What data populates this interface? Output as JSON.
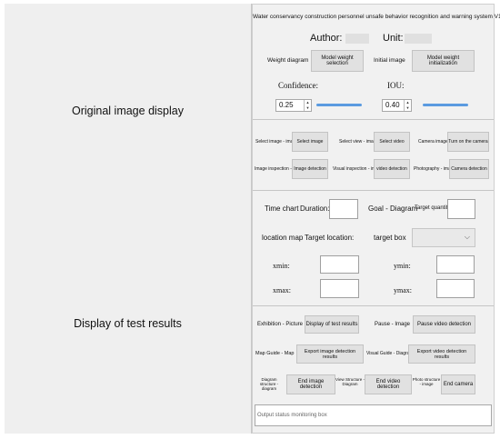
{
  "left": {
    "original_display": "Original image display",
    "results_display": "Display of test results"
  },
  "header": {
    "title": "Water conservancy construction personnel unsafe behavior recognition and warning system V1.0",
    "author_label": "Author:",
    "unit_label": "Unit:"
  },
  "weights": {
    "weight_diagram_label": "Weight diagram",
    "model_weight_selection": "Model weight selection",
    "initial_image_label": "Initial image",
    "model_weight_initialization": "Model weight initialization",
    "confidence_label": "Confidence:",
    "confidence_value": "0.25",
    "iou_label": "IOU:",
    "iou_value": "0.40"
  },
  "sources": {
    "select_image_label": "Select image - image",
    "select_image_button": "Select image",
    "select_video_label": "Select view - image",
    "select_video_button": "Select video",
    "camera_label": "Camera image",
    "camera_button": "Turn on the camera",
    "image_inspection_label": "Image inspection - image",
    "image_detection_button": "Image detection",
    "visual_inspection_label": "Visual inspection - image",
    "video_detection_button": "video detection",
    "photography_label": "Photography - image",
    "camera_detection_button": "Camera detection"
  },
  "results": {
    "time_chart_label": "Time chart",
    "duration_label": "Duration:",
    "goal_diagram_label": "Goal - Diagram",
    "target_quantity_label": "Target quantity:",
    "location_map_label": "location map",
    "target_location_label": "Target location:",
    "target_box_label": "target box",
    "xmin_label": "xmin:",
    "ymin_label": "ymin:",
    "xmax_label": "xmax:",
    "ymax_label": "ymax:"
  },
  "actions": {
    "exhibition_label": "Exhibition - Picture",
    "display_results_button": "Display of test results",
    "pause_label": "Pause - Image",
    "pause_video_button": "Pause video detection",
    "map_guide_label": "Map Guide - Map",
    "export_image_button": "Export image detection results",
    "visual_guide_label": "Visual Guide - Diagram",
    "export_video_button": "Export video detection results",
    "diagram_structure_label": "Diagram structure - diagram",
    "end_image_button": "End image detection",
    "view_structure_label": "View Structure - Diagram",
    "end_video_button": "End video detection",
    "photo_structure_label": "Photo structure - image",
    "end_camera_button": "End camera"
  },
  "status": {
    "placeholder": "Output status monitoring box"
  },
  "colors": {
    "slider": "#5b9be0"
  }
}
